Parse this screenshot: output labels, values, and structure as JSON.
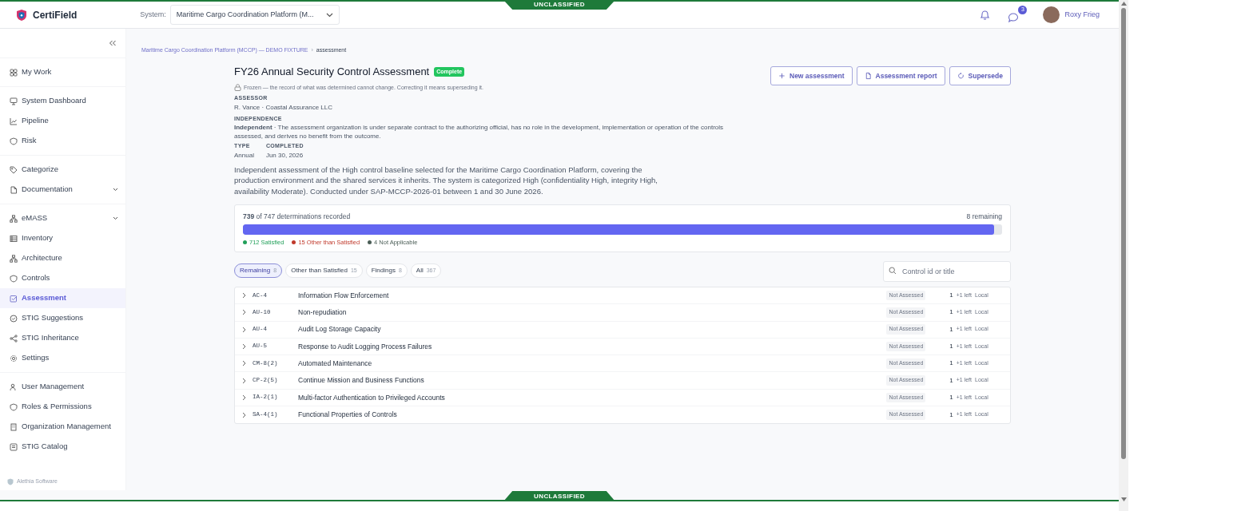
{
  "banner": {
    "top": "UNCLASSIFIED",
    "bottom": "UNCLASSIFIED"
  },
  "header": {
    "app_name": "CertiField",
    "system_label": "System:",
    "system_value": "Maritime Cargo Coordination Platform (M...",
    "messages_badge": "3",
    "user_name": "Roxy Frieg"
  },
  "sidebar": {
    "groups": [
      [
        {
          "label": "My Work",
          "selected": false
        }
      ],
      [
        {
          "label": "System Dashboard",
          "selected": false
        },
        {
          "label": "Pipeline",
          "selected": false
        },
        {
          "label": "Risk",
          "selected": false
        }
      ],
      [
        {
          "label": "Categorize",
          "selected": false
        },
        {
          "label": "Documentation",
          "selected": false,
          "expandable": true
        }
      ],
      [
        {
          "label": "eMASS",
          "selected": false,
          "expandable": true
        },
        {
          "label": "Inventory",
          "selected": false
        },
        {
          "label": "Architecture",
          "selected": false
        },
        {
          "label": "Controls",
          "selected": false
        },
        {
          "label": "Assessment",
          "selected": true
        },
        {
          "label": "STIG Suggestions",
          "selected": false
        },
        {
          "label": "STIG Inheritance",
          "selected": false
        },
        {
          "label": "Settings",
          "selected": false
        }
      ],
      [
        {
          "label": "User Management",
          "selected": false
        },
        {
          "label": "Roles & Permissions",
          "selected": false
        },
        {
          "label": "Organization Management",
          "selected": false
        },
        {
          "label": "STIG Catalog",
          "selected": false
        }
      ]
    ],
    "footer": "Alethia Software"
  },
  "breadcrumb": [
    "Maritime Cargo Coordination Platform (MCCP) — DEMO FIXTURE",
    "assessment"
  ],
  "breadcrumb_separator": "›",
  "assessment": {
    "title": "FY26 Annual Security Control Assessment",
    "status": "Complete",
    "frozen_note": "Frozen — the record of what was determined cannot change. Correcting it means superseding it.",
    "assessor_label": "ASSESSOR",
    "assessor": "R. Vance · Coastal Assurance LLC",
    "independence_label": "INDEPENDENCE",
    "independence": "**Independent** · The assessment organization is under separate contract to the authorizing official, has no role in the development, implementation or operation of the controls assessed, and derives no benefit from the outcome.",
    "type_label": "TYPE",
    "type": "Annual",
    "completed_label": "COMPLETED",
    "completed": "Jun 30, 2026",
    "description": "Independent assessment of the High control baseline selected for the Maritime Cargo Coordination Platform, covering the production environment and the shared services it inherits. The system is categorized High (confidentiality High, integrity High, availability Moderate). Conducted under SAP-MCCP-2026-01 between 1 and 30 June 2026."
  },
  "actions": [
    "New assessment",
    "Assessment report",
    "Supersede"
  ],
  "progress": {
    "summary": "**739** of 747 determinations recorded",
    "remaining": "8 remaining",
    "level": 0.989,
    "legend": [
      {
        "label": "712 Satisfied",
        "color": "#22a05a"
      },
      {
        "label": "15 Other than Satisfied",
        "color": "#c0392b"
      },
      {
        "label": "4 Not Applicable",
        "color": "#4b5e57"
      }
    ]
  },
  "filters": [
    {
      "label": "Remaining",
      "count": "8",
      "selected": true
    },
    {
      "label": "Other than Satisfied",
      "count": "15",
      "selected": false
    },
    {
      "label": "Findings",
      "count": "8",
      "selected": false
    },
    {
      "label": "All",
      "count": "367",
      "selected": false
    }
  ],
  "search": {
    "placeholder": "Control id or title"
  },
  "rows": [
    {
      "id": "AC-4",
      "title": "Information Flow Enforcement",
      "status": "Not Assessed",
      "count": "1",
      "left": "+1 left",
      "scope": "Local"
    },
    {
      "id": "AU-10",
      "title": "Non-repudiation",
      "status": "Not Assessed",
      "count": "1",
      "left": "+1 left",
      "scope": "Local"
    },
    {
      "id": "AU-4",
      "title": "Audit Log Storage Capacity",
      "status": "Not Assessed",
      "count": "1",
      "left": "+1 left",
      "scope": "Local"
    },
    {
      "id": "AU-5",
      "title": "Response to Audit Logging Process Failures",
      "status": "Not Assessed",
      "count": "1",
      "left": "+1 left",
      "scope": "Local"
    },
    {
      "id": "CM-8(2)",
      "title": "Automated Maintenance",
      "status": "Not Assessed",
      "count": "1",
      "left": "+1 left",
      "scope": "Local"
    },
    {
      "id": "CP-2(5)",
      "title": "Continue Mission and Business Functions",
      "status": "Not Assessed",
      "count": "1",
      "left": "+1 left",
      "scope": "Local"
    },
    {
      "id": "IA-2(1)",
      "title": "Multi-factor Authentication to Privileged Accounts",
      "status": "Not Assessed",
      "count": "1",
      "left": "+1 left",
      "scope": "Local"
    },
    {
      "id": "SA-4(1)",
      "title": "Functional Properties of Controls",
      "status": "Not Assessed",
      "count": "1",
      "left": "+1 left",
      "scope": "Local"
    }
  ]
}
